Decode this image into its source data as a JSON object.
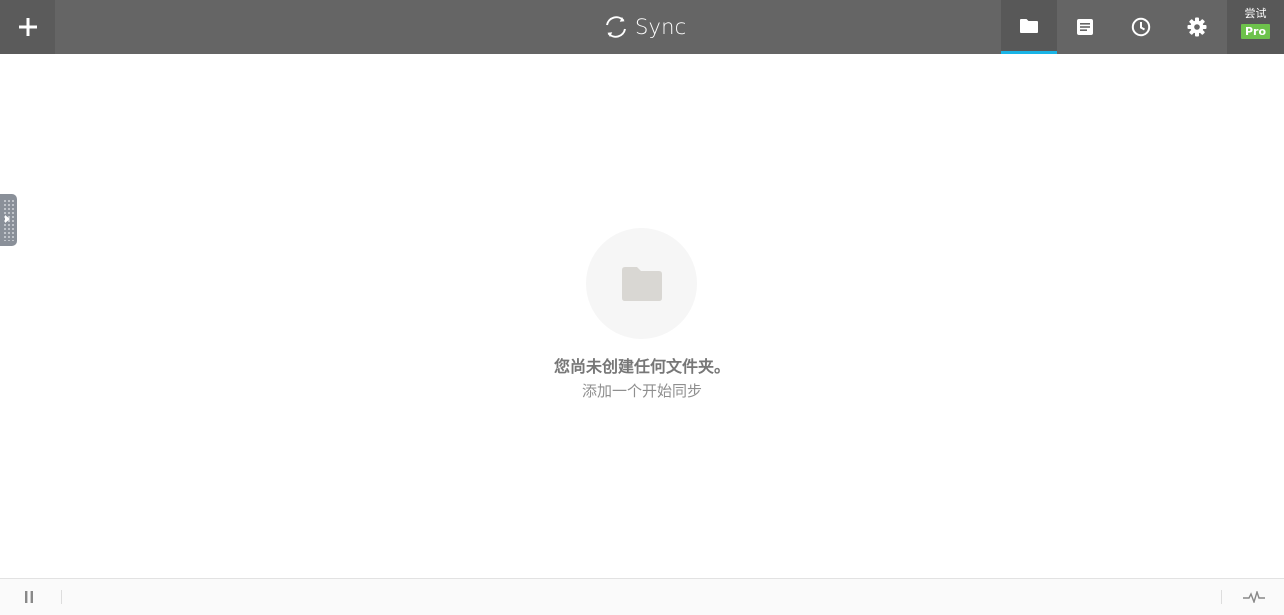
{
  "header": {
    "app_title": "Sync",
    "add_icon": "plus-icon",
    "brand_icon": "sync-arrows-icon",
    "tabs": [
      {
        "id": "folders",
        "icon": "folder-icon",
        "active": true
      },
      {
        "id": "transfers",
        "icon": "document-icon",
        "active": false
      },
      {
        "id": "history",
        "icon": "clock-icon",
        "active": false
      },
      {
        "id": "preferences",
        "icon": "gear-icon",
        "active": false
      }
    ],
    "pro": {
      "label": "尝试",
      "badge": "Pro"
    }
  },
  "empty_state": {
    "icon": "folder-icon",
    "title": "您尚未创建任何文件夹。",
    "subtitle": "添加一个开始同步"
  },
  "statusbar": {
    "pause_icon": "pause-icon",
    "activity_icon": "activity-pulse-icon"
  },
  "colors": {
    "topbar": "#656565",
    "active_tab_underline": "#19b4e6",
    "pro_badge": "#6dc24b",
    "empty_folder": "#d9d7d3"
  }
}
